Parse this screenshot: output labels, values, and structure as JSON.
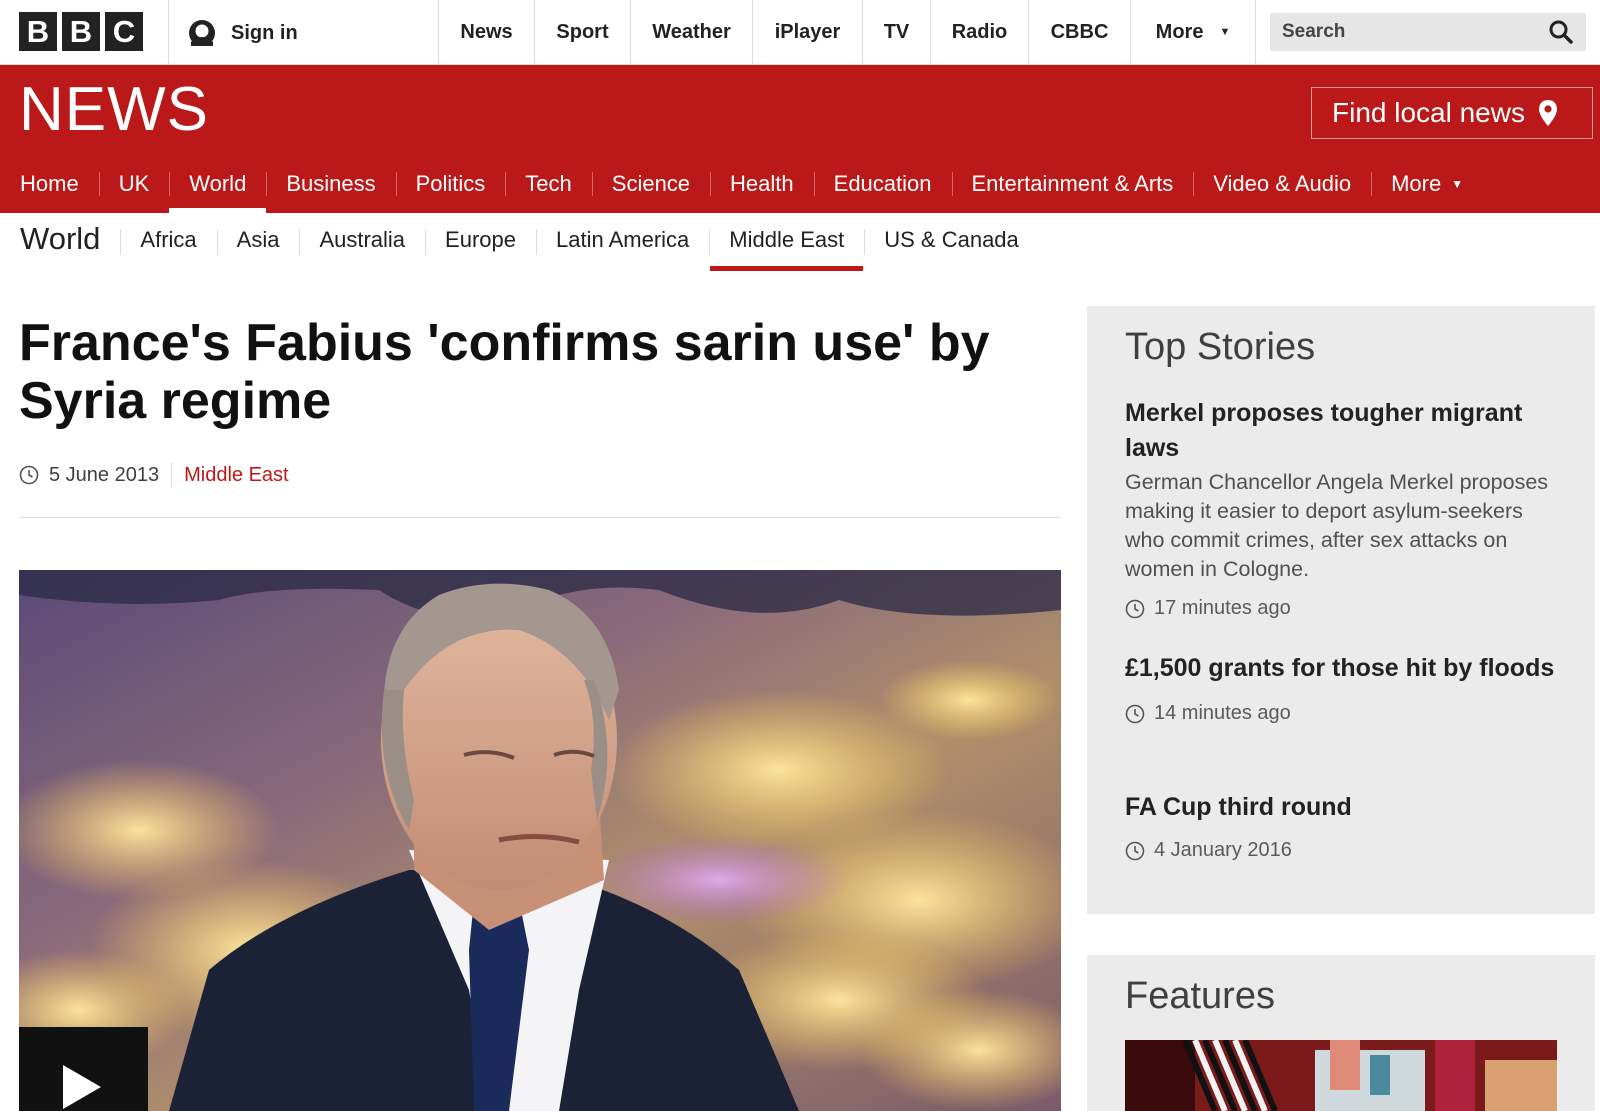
{
  "brand": {
    "logo_letters": [
      "B",
      "B",
      "C"
    ],
    "news_logo": "NEWS",
    "accent_color": "#bb1919"
  },
  "topbar": {
    "signin_label": "Sign in",
    "nav": [
      "News",
      "Sport",
      "Weather",
      "iPlayer",
      "TV",
      "Radio",
      "CBBC",
      "More"
    ],
    "search_placeholder": "Search"
  },
  "masthead": {
    "find_local": "Find local news"
  },
  "section_nav": {
    "items": [
      "Home",
      "UK",
      "World",
      "Business",
      "Politics",
      "Tech",
      "Science",
      "Health",
      "Education",
      "Entertainment & Arts",
      "Video & Audio",
      "More"
    ],
    "active": "World"
  },
  "sub_nav": {
    "title": "World",
    "items": [
      "Africa",
      "Asia",
      "Australia",
      "Europe",
      "Latin America",
      "Middle East",
      "US & Canada"
    ],
    "active": "Middle East"
  },
  "article": {
    "headline": "France's Fabius 'confirms sarin use' by Syria regime",
    "date": "5 June 2013",
    "category": "Middle East"
  },
  "sidebar": {
    "top_stories_title": "Top Stories",
    "stories": [
      {
        "title": "Merkel proposes tougher migrant laws",
        "summary": "German Chancellor Angela Merkel proposes making it easier to deport asylum-seekers who commit crimes, after sex attacks on women in Cologne.",
        "time": "17 minutes ago"
      },
      {
        "title": "£1,500 grants for those hit by floods",
        "summary": "",
        "time": "14 minutes ago"
      },
      {
        "title": "FA Cup third round",
        "summary": "",
        "time": "4 January 2016"
      }
    ],
    "features_title": "Features"
  }
}
